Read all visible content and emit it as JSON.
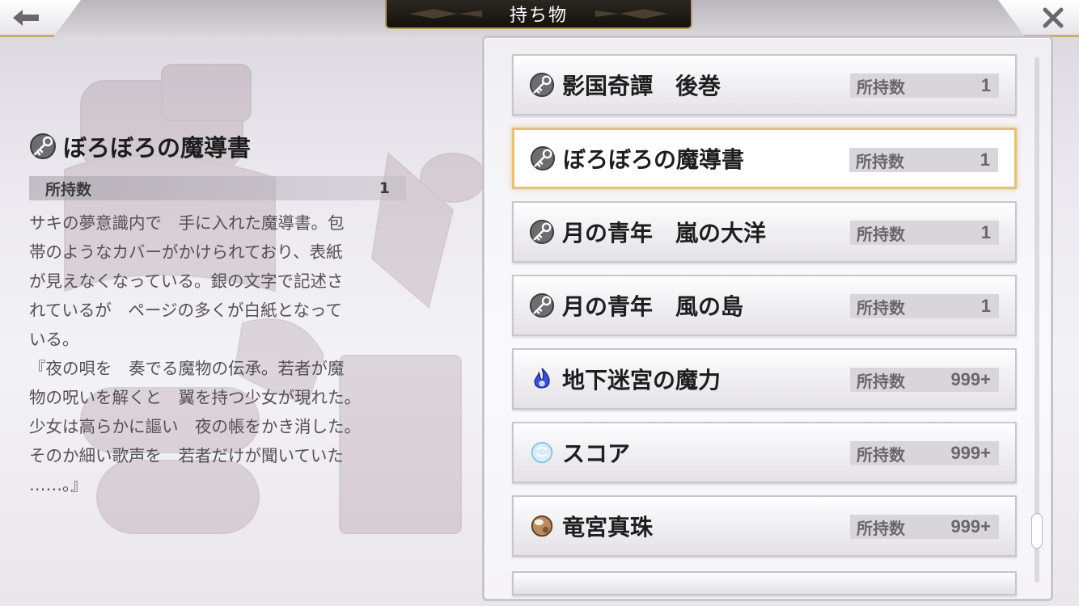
{
  "header": {
    "title": "持ち物",
    "back_icon": "back-arrow-icon",
    "close_icon": "close-icon"
  },
  "detail": {
    "name": "ぼろぼろの魔導書",
    "count_label": "所持数",
    "count_value": "1",
    "description": "サキの夢意識内で　手に入れた魔導書。包\n帯のようなカバーがかけられており、表紙\nが見えなくなっている。銀の文字で記述さ\nれているが　ページの多くが白紙となって\nいる。\n『夜の唄を　奏でる魔物の伝承。若者が魔\n物の呪いを解くと　翼を持つ少女が現れた。\n少女は高らかに謳い　夜の帳をかき消した。\nそのか細い歌声を　若者だけが聞いていた\n……。』"
  },
  "items": [
    {
      "name": "影国奇譚　後巻",
      "count_label": "所持数",
      "count": "1",
      "icon": "key-icon",
      "selected": false
    },
    {
      "name": "ぼろぼろの魔導書",
      "count_label": "所持数",
      "count": "1",
      "icon": "key-icon",
      "selected": true
    },
    {
      "name": "月の青年　嵐の大洋",
      "count_label": "所持数",
      "count": "1",
      "icon": "key-icon",
      "selected": false
    },
    {
      "name": "月の青年　風の島",
      "count_label": "所持数",
      "count": "1",
      "icon": "key-icon",
      "selected": false
    },
    {
      "name": "地下迷宮の魔力",
      "count_label": "所持数",
      "count": "999+",
      "icon": "blue-flame-icon",
      "selected": false
    },
    {
      "name": "スコア",
      "count_label": "所持数",
      "count": "999+",
      "icon": "ice-orb-icon",
      "selected": false
    },
    {
      "name": "竜宮真珠",
      "count_label": "所持数",
      "count": "999+",
      "icon": "pearl-icon",
      "selected": false
    }
  ],
  "scroll": {
    "position_fraction": 0.93
  },
  "colors": {
    "selected_border": "#e2c27a",
    "title_plate": "#1c1813",
    "accent_gold": "#c9ad6a"
  }
}
